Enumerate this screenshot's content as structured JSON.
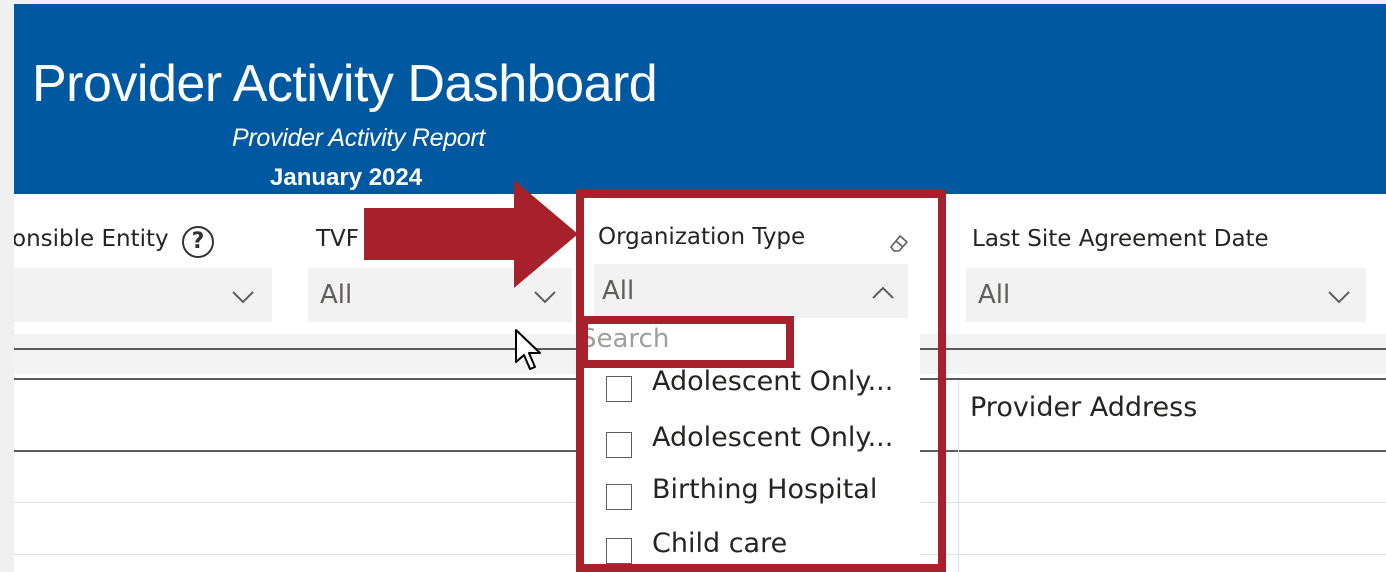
{
  "header": {
    "title": "Provider Activity Dashboard",
    "subtitle": "Provider Activity Report",
    "date": "January 2024"
  },
  "slicers": [
    {
      "label": "onsible Entity",
      "value": "",
      "has_help": true
    },
    {
      "label": "TVF",
      "value": "All"
    },
    {
      "label": "Organization Type",
      "value": "All",
      "expanded": true
    },
    {
      "label": "Last Site Agreement Date",
      "value": "All"
    }
  ],
  "search": {
    "placeholder": "Search"
  },
  "org_type_options": [
    {
      "label": "Adolescent Only...",
      "checked": false
    },
    {
      "label": "Adolescent Only...",
      "checked": false
    },
    {
      "label": "Birthing Hospital",
      "checked": false
    },
    {
      "label": "Child care",
      "checked": false
    }
  ],
  "table": {
    "column_header": "Provider Address"
  },
  "colors": {
    "header_bg": "#0059a0",
    "highlight": "#a6212b",
    "dropdown_bg": "#f2f2f2"
  },
  "icons": [
    "help-icon",
    "chevron-down-icon",
    "chevron-up-icon",
    "eraser-icon",
    "checkbox-icon",
    "mouse-pointer-icon",
    "arrow-icon"
  ]
}
